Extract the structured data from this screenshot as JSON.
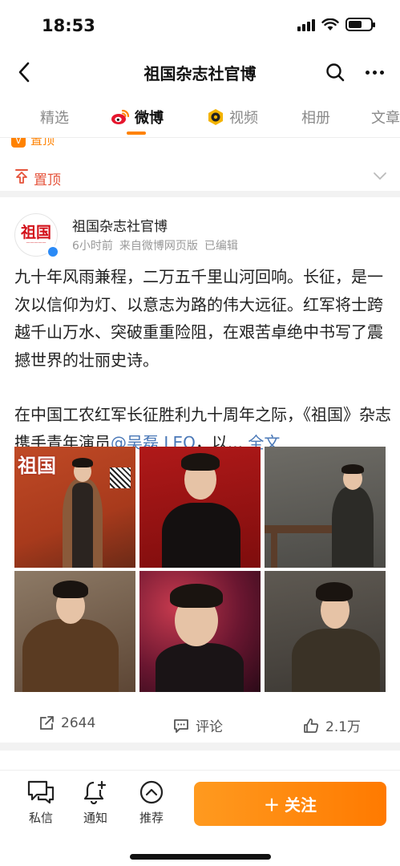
{
  "status": {
    "time": "18:53"
  },
  "nav": {
    "title": "祖国杂志社官博"
  },
  "tabs": [
    {
      "label": "精选"
    },
    {
      "label": "微博"
    },
    {
      "label": "视频"
    },
    {
      "label": "相册"
    },
    {
      "label": "文章"
    }
  ],
  "pinned": {
    "top_label": "置顶",
    "label": "置顶"
  },
  "post": {
    "author": "祖国杂志社官博",
    "avatar_text": "祖国",
    "meta": {
      "time": "6小时前",
      "source": "来自微博网页版",
      "edited": "已编辑"
    },
    "paragraph1": "九十年风雨兼程，二万五千里山河回响。长征，是一次以信仰为灯、以意志为路的伟大远征。红军将士跨越千山万水、突破重重险阻，在艰苦卓绝中书写了震撼世界的壮丽史诗。",
    "paragraph2_prefix": "在中国工农红军长征胜利九十周年之际，《祖国》杂志携手青年演员",
    "mention": "@吴磊 LEO",
    "paragraph2_suffix": "，以...",
    "full_text": "全文",
    "cover_logo": "祖国",
    "actions": {
      "shares": "2644",
      "comment_label": "评论",
      "likes": "2.1万"
    }
  },
  "bottom_bar": {
    "messages": "私信",
    "notifications": "通知",
    "recommend": "推荐",
    "follow": "关注",
    "follow_plus": "＋"
  },
  "colors": {
    "accent": "#ff8200",
    "link": "#4a78b7",
    "pin": "#e5533b"
  }
}
